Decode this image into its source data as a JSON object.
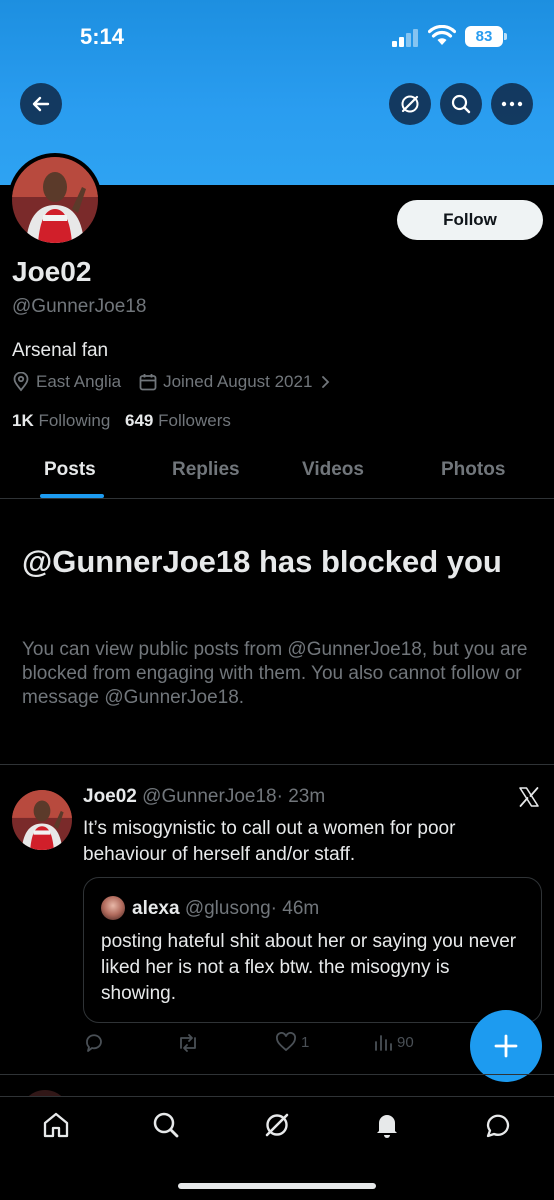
{
  "status_bar": {
    "time": "5:14",
    "battery": "83"
  },
  "profile": {
    "name": "Joe02",
    "handle": "@GunnerJoe18",
    "bio": "Arsenal fan",
    "location": "East Anglia",
    "joined": "Joined August 2021",
    "following_count": "1K",
    "following_label": "Following",
    "followers_count": "649",
    "followers_label": "Followers",
    "follow_label": "Follow"
  },
  "tabs": [
    {
      "label": "Posts",
      "active": true
    },
    {
      "label": "Replies",
      "active": false
    },
    {
      "label": "Videos",
      "active": false
    },
    {
      "label": "Photos",
      "active": false
    }
  ],
  "blocked": {
    "title": "@GunnerJoe18 has blocked you",
    "description": "You can view public posts from @GunnerJoe18, but you are blocked from engaging with them. You also cannot follow or message @GunnerJoe18."
  },
  "tweet": {
    "name": "Joe02",
    "handle": "@GunnerJoe18",
    "time": "· 23m",
    "text": "It’s misogynistic to call out a women for poor behaviour of herself and/or staff.",
    "quote": {
      "name": "alexa",
      "handle": "@glusong",
      "time": "· 46m",
      "text": "posting hateful shit about her or saying you never liked her is not a flex btw. the misogyny is showing."
    },
    "likes": "1",
    "views": "90"
  },
  "colors": {
    "accent": "#1d9bf0",
    "banner": "#2a9df0",
    "muted": "#71767b",
    "text": "#e7e9ea"
  }
}
